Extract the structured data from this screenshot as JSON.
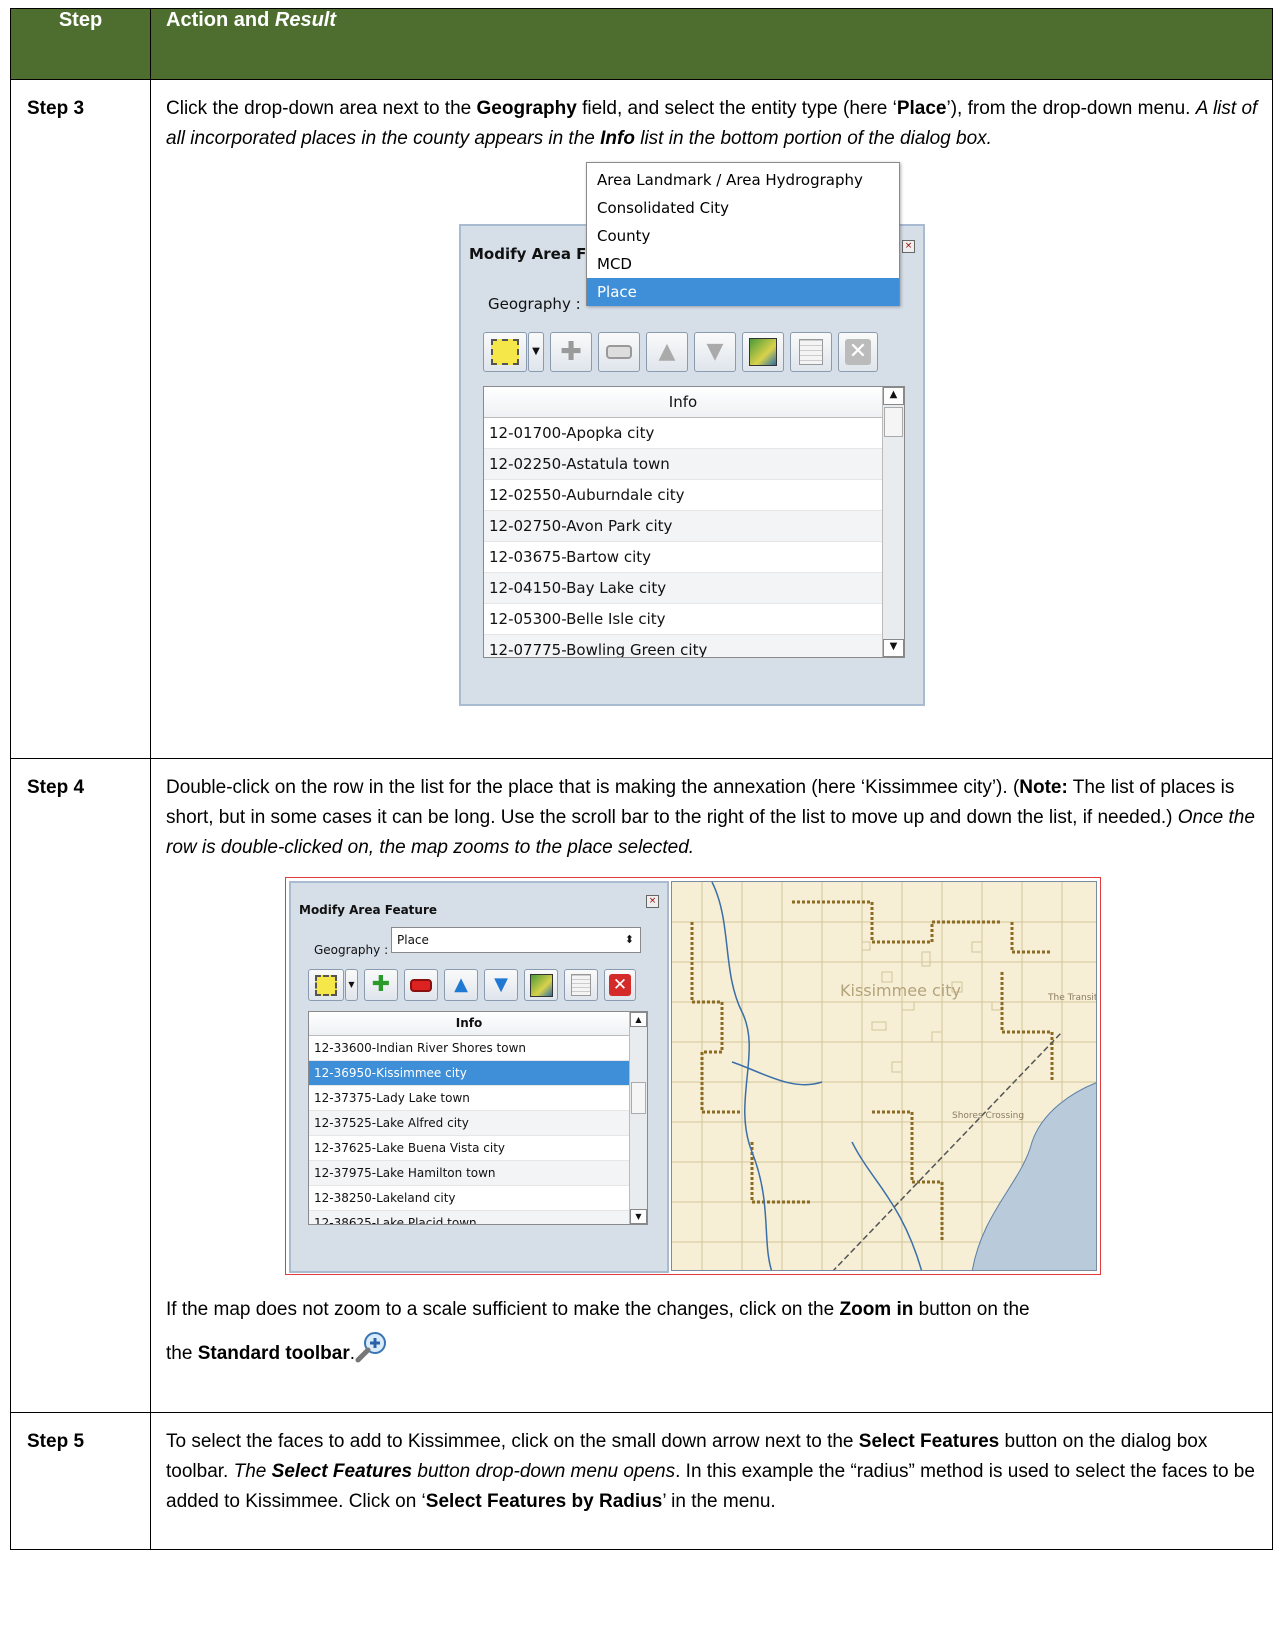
{
  "header": {
    "col1": "Step",
    "col2_normal": "Action and ",
    "col2_italic": "Result"
  },
  "step3": {
    "label": "Step 3",
    "text": {
      "a": "Click the drop-down area next to the ",
      "b": "Geography",
      "c": " field, and select the entity type (here ‘",
      "d": "Place",
      "e": "’), from the drop-down menu. ",
      "f": "A list of all incorporated places in the county appears in the ",
      "g": "Info",
      "h": " list in the bottom portion of the dialog box."
    },
    "dialog": {
      "title": "Modify Area Fe",
      "geography_label": "Geography :",
      "menu_items": [
        "Area Landmark / Area Hydrography",
        "Consolidated City",
        "County",
        "MCD",
        "Place"
      ],
      "selected_menu_item": "Place",
      "info_header": "Info",
      "rows": [
        "12-01700-Apopka city",
        "12-02250-Astatula town",
        "12-02550-Auburndale city",
        "12-02750-Avon Park city",
        "12-03675-Bartow city",
        "12-04150-Bay Lake city",
        "12-05300-Belle Isle city",
        "12-07775-Bowling Green city"
      ]
    }
  },
  "step4": {
    "label": "Step 4",
    "text": {
      "a": "Double-click on the row in the list for the place that is making the annexation (here ‘Kissimmee city’). (",
      "b": "Note:",
      "c": "  The list of places is short, but in some cases it can be long. Use the scroll bar to the right of the list to move up and down the list, if needed.) ",
      "d": "Once the row is double-clicked on, the map zooms to the place selected."
    },
    "dialog": {
      "title": "Modify Area Feature",
      "geography_label": "Geography :",
      "geography_value": "Place",
      "info_header": "Info",
      "rows": [
        "12-33600-Indian River Shores town",
        "12-36950-Kissimmee city",
        "12-37375-Lady Lake town",
        "12-37525-Lake Alfred city",
        "12-37625-Lake Buena Vista city",
        "12-37975-Lake Hamilton town",
        "12-38250-Lakeland city",
        "12-38625-Lake Placid town"
      ],
      "selected_row": "12-36950-Kissimmee city"
    },
    "map": {
      "city_label": "Kissimmee city",
      "label2": "Shores Crossing",
      "label3": "The Transit"
    },
    "note": {
      "a": "If the map does not zoom to a scale sufficient to make the changes, click on the ",
      "b": "Zoom in",
      "c": " button on the ",
      "d": "Standard toolbar",
      "e": "."
    }
  },
  "step5": {
    "label": "Step 5",
    "text": {
      "a": "To select the faces to add to Kissimmee, click on the small down arrow next to the ",
      "b": "Select Features",
      "c": " button on the dialog box toolbar. ",
      "d": "The ",
      "e": "Select Features",
      "f": " button drop-down menu opens",
      "g": ". In this example the “radius” method is used to select the faces to be added to Kissimmee. Click on ‘",
      "h": "Select Features by Radius",
      "i": "’ in the menu."
    }
  },
  "colors": {
    "header_bg": "#4d6e2e",
    "selection": "#3e8ed8",
    "figure_border": "#e03c3c"
  },
  "icons": [
    "select-features-icon",
    "add-icon",
    "remove-icon",
    "up-icon",
    "down-icon",
    "map-edit-icon",
    "table-icon",
    "close-icon",
    "zoom-in-icon",
    "mouse-cursor-icon"
  ]
}
